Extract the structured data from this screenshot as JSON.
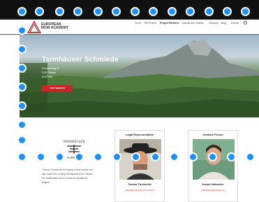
{
  "topbar": {
    "left_items": [
      "",
      "",
      "",
      ""
    ],
    "right_items": [
      "",
      ""
    ]
  },
  "logo": {
    "line1": "EUROPEAN",
    "line2": "IRON ACADEMY"
  },
  "nav": {
    "items": [
      "Home",
      "The Project",
      "Project Partners",
      "Outputs and Toolkits",
      "Glossary",
      "Blog",
      "Events"
    ],
    "active": "Project Partners"
  },
  "hero": {
    "title": "Tannhäuser Schmiede",
    "address": [
      "Prochenberg 11",
      "3345 Ybbsitz",
      "AUSTRIA"
    ],
    "cta_label": "VISIT WEBSITE"
  },
  "company": {
    "logo_text_top": "TANNHÄUSER",
    "logo_text_bottom": "SCHMIEDE",
    "description": "Thomas Tischtschin for forging at and around and also custom for leading Handwerkerinnen Ybbsitz. Für traditionelle und für Cross-for-Qualität für jüngere..."
  },
  "cards": [
    {
      "heading": "Legal Representative",
      "name": "Thomas Tischtschin",
      "link": "office@tannhauserschmiede.at"
    },
    {
      "heading": "Contact Person",
      "name": "Joseph Hofmacher",
      "link": "j.hofmacher@ypsilon.com"
    }
  ],
  "colors": {
    "accent": "#c62828",
    "topbar": "#111111",
    "dot": "#1e90ff"
  }
}
